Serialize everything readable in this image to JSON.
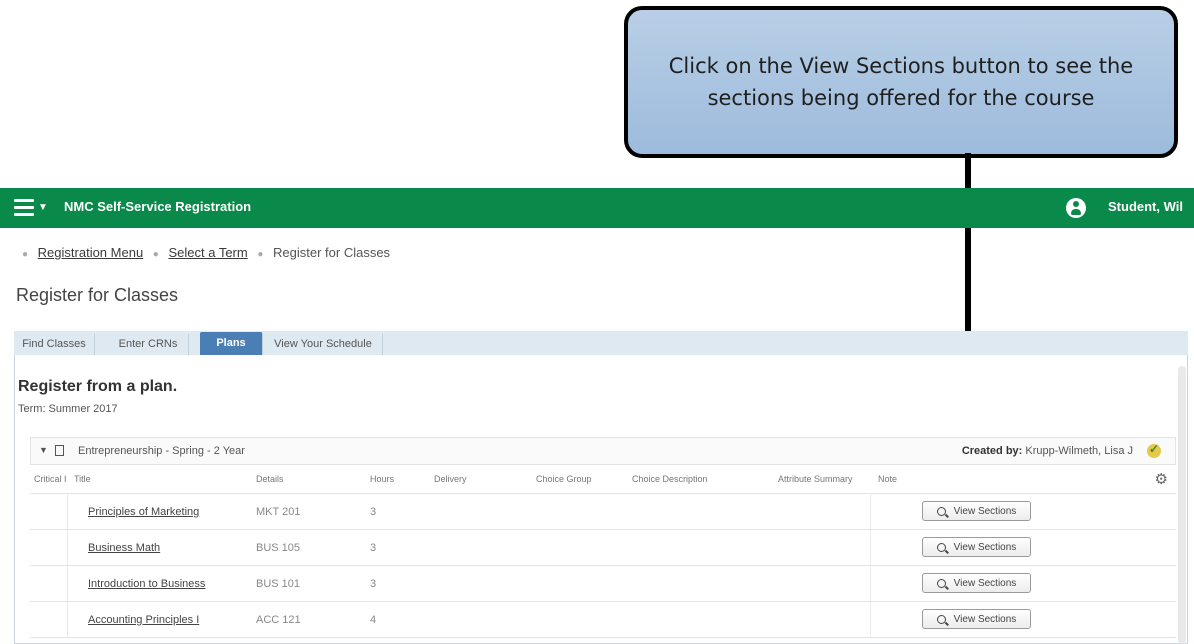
{
  "callout": {
    "text": "Click on the View Sections button to see the sections being offered for the course"
  },
  "header": {
    "app_title": "NMC Self-Service Registration",
    "user_name": "Student, Wil"
  },
  "breadcrumb": {
    "items": [
      "Registration Menu",
      "Select a Term",
      "Register for Classes"
    ]
  },
  "page_title": "Register for Classes",
  "tabs": [
    {
      "label": "Find Classes",
      "active": false
    },
    {
      "label": "Enter CRNs",
      "active": false
    },
    {
      "label": "Plans",
      "active": true
    },
    {
      "label": "View Your Schedule",
      "active": false
    }
  ],
  "plan": {
    "heading": "Register from a plan.",
    "term": "Term: Summer 2017",
    "name": "Entrepreneurship - Spring - 2 Year",
    "created_label": "Created by:",
    "created_by": "Krupp-Wilmeth, Lisa J"
  },
  "columns": [
    "Critical I",
    "Title",
    "Details",
    "Hours",
    "Delivery",
    "Choice Group",
    "Choice Description",
    "Attribute Summary",
    "Note"
  ],
  "rows": [
    {
      "title": "Principles of Marketing",
      "details": "MKT 201",
      "hours": "3",
      "button": "View Sections"
    },
    {
      "title": "Business Math",
      "details": "BUS 105",
      "hours": "3",
      "button": "View Sections"
    },
    {
      "title": "Introduction to Business",
      "details": "BUS 101",
      "hours": "3",
      "button": "View Sections"
    },
    {
      "title": "Accounting Principles I",
      "details": "ACC 121",
      "hours": "4",
      "button": "View Sections"
    }
  ],
  "colors": {
    "header_green": "#0a8a4a",
    "active_tab": "#4a7fb5",
    "callout_fill": "#9dbbdc"
  }
}
